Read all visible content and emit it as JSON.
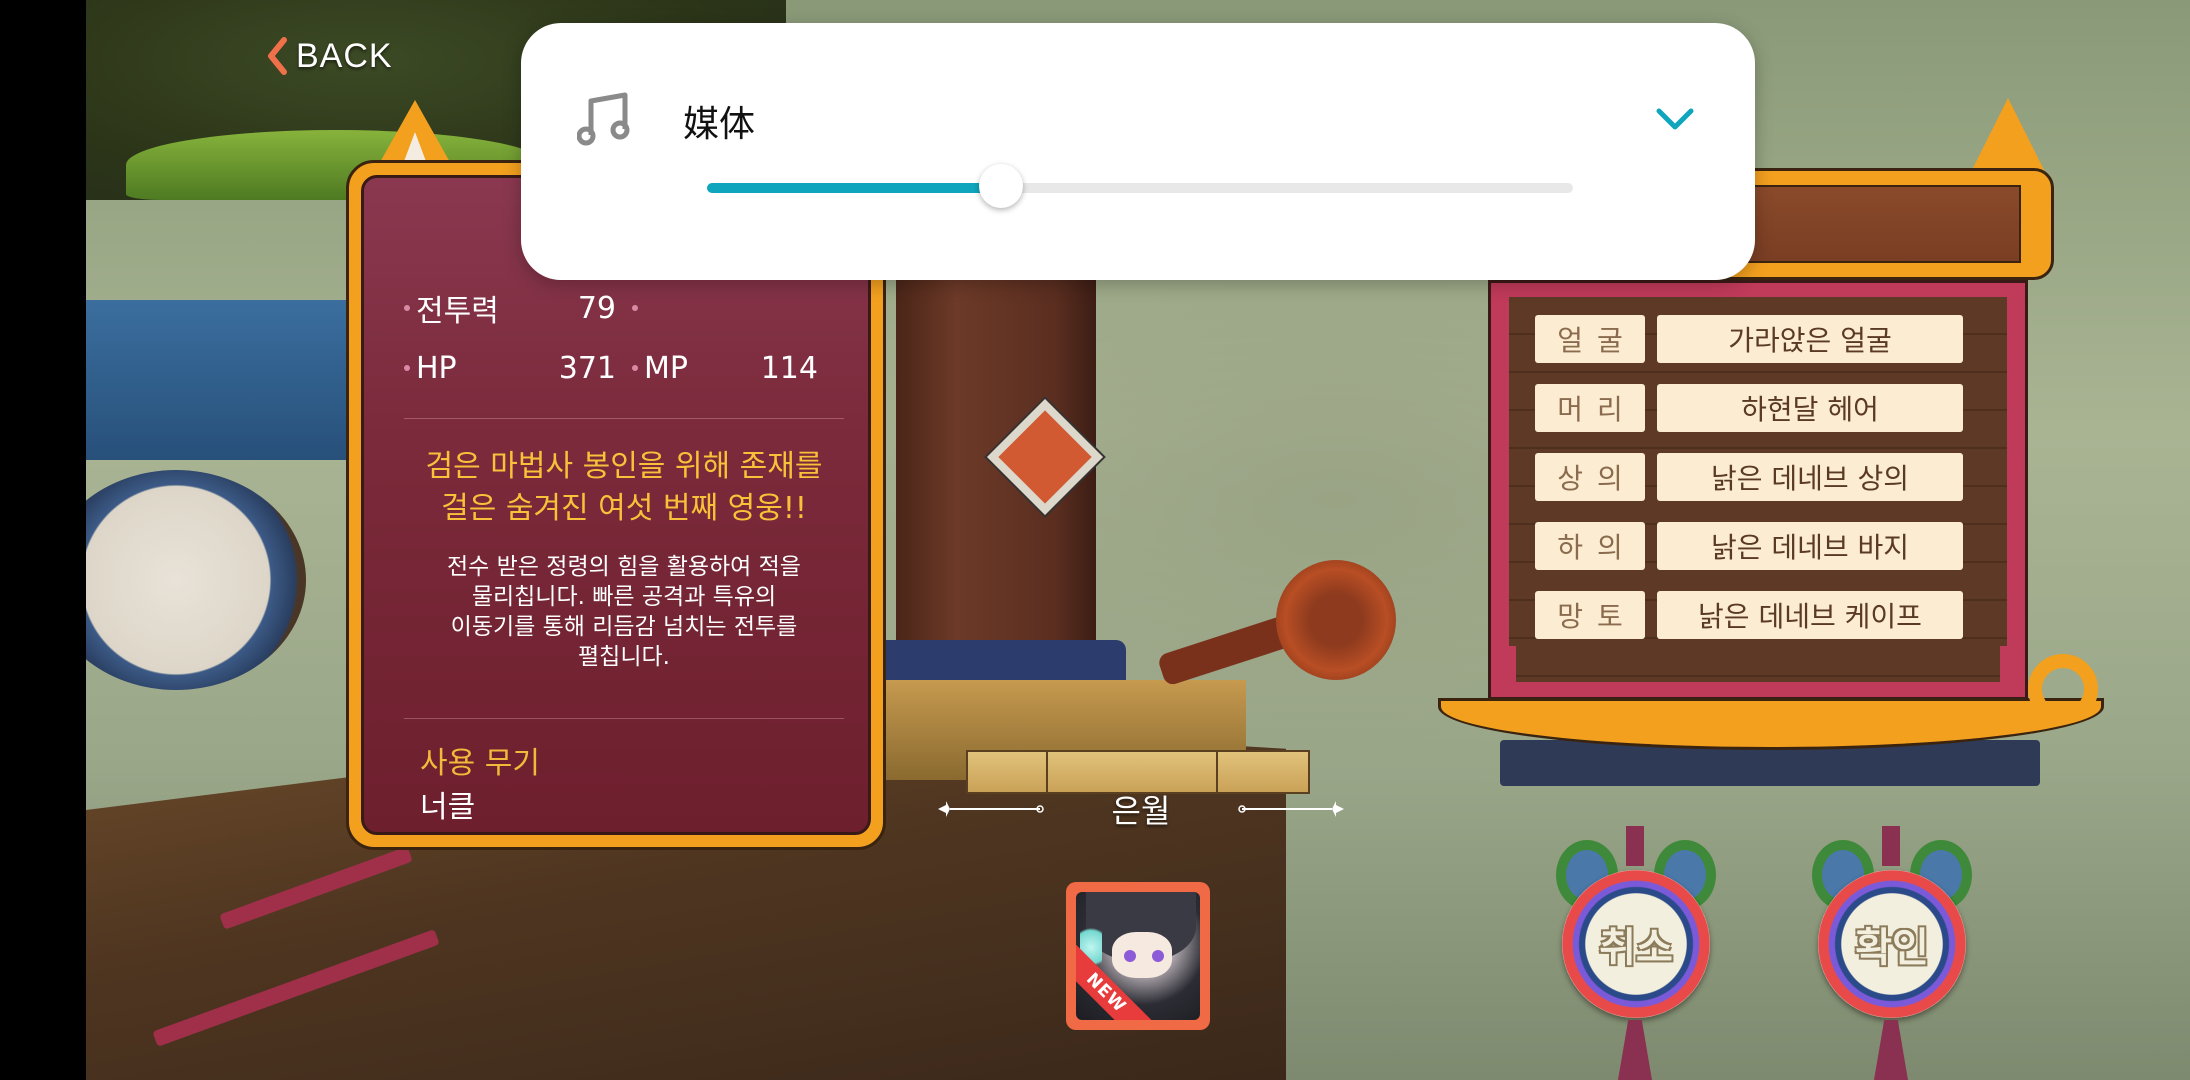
{
  "navigation": {
    "back_label": "BACK"
  },
  "character_info": {
    "stats": [
      {
        "label": "전투력",
        "value": "79",
        "label2": "",
        "value2": ""
      },
      {
        "label": "HP",
        "value": "371",
        "label2": "MP",
        "value2": "114"
      }
    ],
    "headline": "검은 마법사 봉인을 위해 존재를 걸은 숨겨진 여섯 번째 영웅!!",
    "headline_lines": [
      "검은 마법사 봉인을 위해 존재를",
      "걸은 숨겨진 여섯 번째 영웅!!"
    ],
    "description_lines": [
      "전수 받은 정령의 힘을 활용하여 적을",
      "물리칩니다. 빠른 공격과 특유의",
      "이동기를 통해 리듬감 넘치는 전투를",
      "펼칩니다."
    ],
    "weapon_label": "사용 무기",
    "weapon_value": "너클"
  },
  "class_selection": {
    "class_name": "은월",
    "portrait_badge": "NEW"
  },
  "costume": {
    "items": [
      {
        "label": "얼굴",
        "value": "가라앉은 얼굴"
      },
      {
        "label": "머리",
        "value": "하현달 헤어"
      },
      {
        "label": "상의",
        "value": "낡은 데네브 상의"
      },
      {
        "label": "하의",
        "value": "낡은 데네브 바지"
      },
      {
        "label": "망토",
        "value": "낡은 데네브 케이프"
      }
    ]
  },
  "actions": {
    "cancel_label": "취소",
    "confirm_label": "확인"
  },
  "volume_overlay": {
    "stream_label": "媒体",
    "icon": "music-note-icon",
    "expand_icon": "chevron-down-icon",
    "level_percent": 34,
    "accent_color": "#0fa5bd"
  }
}
